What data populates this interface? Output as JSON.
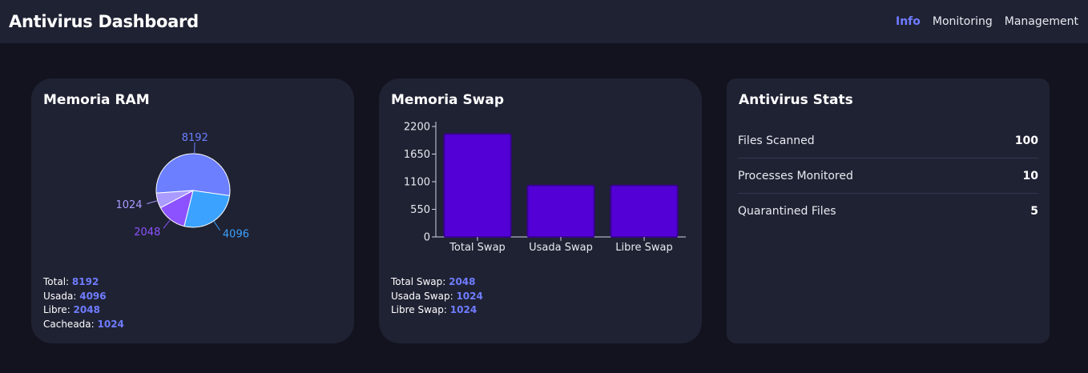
{
  "header": {
    "title": "Antivirus Dashboard",
    "nav": [
      {
        "label": "Info",
        "active": true
      },
      {
        "label": "Monitoring",
        "active": false
      },
      {
        "label": "Management",
        "active": false
      }
    ]
  },
  "ram": {
    "title": "Memoria RAM",
    "legend": [
      {
        "label": "Total: ",
        "value": "8192"
      },
      {
        "label": "Usada: ",
        "value": "4096"
      },
      {
        "label": "Libre: ",
        "value": "2048"
      },
      {
        "label": "Cacheada: ",
        "value": "1024"
      }
    ]
  },
  "swap": {
    "title": "Memoria Swap",
    "legend": [
      {
        "label": "Total Swap: ",
        "value": "2048"
      },
      {
        "label": "Usada Swap: ",
        "value": "1024"
      },
      {
        "label": "Libre Swap: ",
        "value": "1024"
      }
    ]
  },
  "stats": {
    "title": "Antivirus Stats",
    "rows": [
      {
        "label": "Files Scanned",
        "value": "100"
      },
      {
        "label": "Processes Monitored",
        "value": "10"
      },
      {
        "label": "Quarantined Files",
        "value": "5"
      }
    ]
  },
  "colors": {
    "accent": "#6f7cff",
    "pie": [
      "#6c7fff",
      "#3ba2ff",
      "#8d52ff",
      "#a99bff"
    ],
    "bar": "#5200d6",
    "bar_stroke": "#3a0096"
  },
  "chart_data": [
    {
      "type": "pie",
      "title": "Memoria RAM",
      "categories": [
        "Total",
        "Usada",
        "Libre",
        "Cacheada"
      ],
      "values": [
        8192,
        4096,
        2048,
        1024
      ]
    },
    {
      "type": "bar",
      "title": "Memoria Swap",
      "categories": [
        "Total Swap",
        "Usada Swap",
        "Libre Swap"
      ],
      "values": [
        2048,
        1024,
        1024
      ],
      "yticks": [
        0,
        550,
        1100,
        1650,
        2200
      ],
      "ylim": [
        0,
        2200
      ],
      "grid": false
    }
  ]
}
